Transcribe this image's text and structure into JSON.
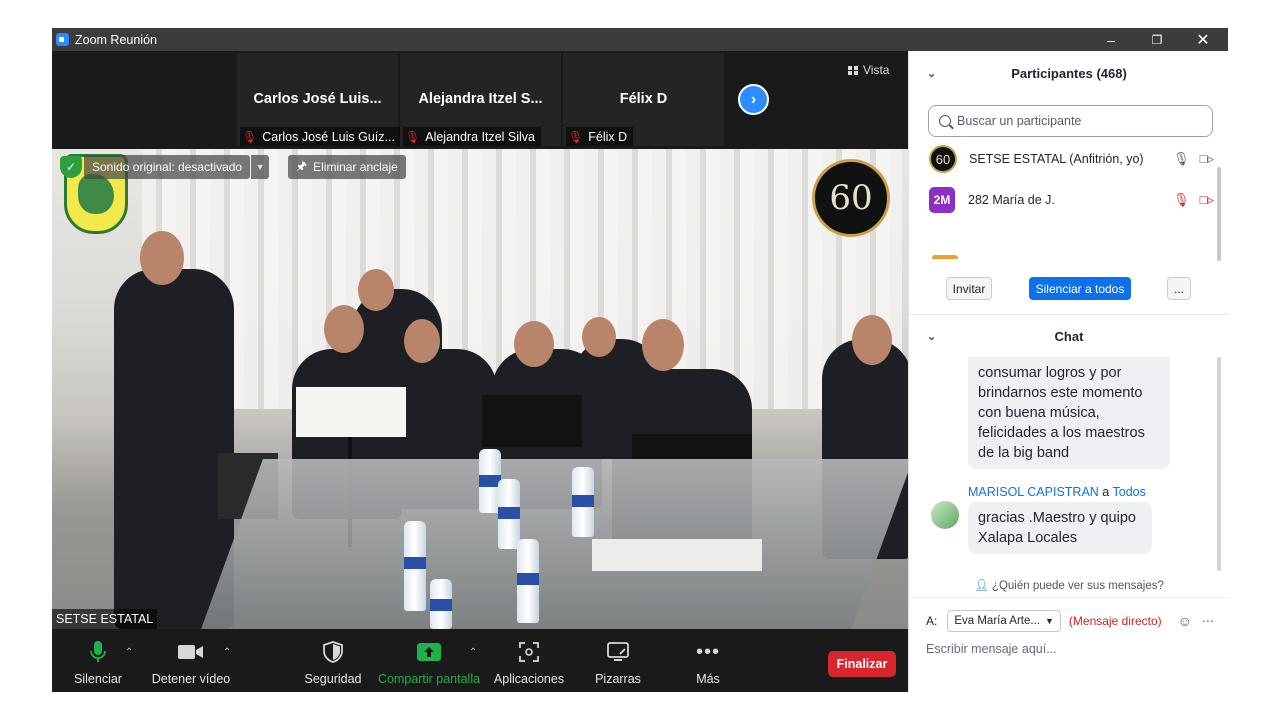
{
  "window": {
    "title": "Zoom Reunión"
  },
  "strip": {
    "thumbnails": [
      {
        "name": "Carlos José Luis...",
        "label": "Carlos José Luis Guíz..."
      },
      {
        "name": "Alejandra  Itzel S...",
        "label": "Alejandra Itzel Silva"
      },
      {
        "name": "Félix D",
        "label": "Félix D"
      }
    ],
    "view_label": "Vista"
  },
  "main_video": {
    "original_sound": "Sonido original: desactivado",
    "unpin": "Eliminar anclaje",
    "badge": "60",
    "speaker_name": "SETSE ESTATAL"
  },
  "toolbar": {
    "mute": "Silenciar",
    "stop_video": "Detener vídeo",
    "security": "Seguridad",
    "share_screen": "Compartir pantalla",
    "apps": "Aplicaciones",
    "whiteboards": "Pizarras",
    "more": "Más",
    "end": "Finalizar"
  },
  "participants": {
    "header": "Participantes (468)",
    "search_placeholder": "Buscar un participante",
    "list": [
      {
        "avatar": "60",
        "name": "SETSE ESTATAL (Anfitrión, yo)"
      },
      {
        "avatar": "2M",
        "name": "282 María de J."
      }
    ],
    "invite": "Invitar",
    "mute_all": "Silenciar a todos",
    "more": "..."
  },
  "chat": {
    "header": "Chat",
    "messages": [
      {
        "text": "consumar logros y por brindarnos este momento con buena música, felicidades a los maestros de la big band"
      },
      {
        "sender": "MARISOL CAPISTRAN",
        "sep": "a",
        "recipient": "Todos",
        "text": "gracias .Maestro y quipo Xalapa Locales"
      }
    ],
    "who_can_see": "¿Quién puede ver sus mensajes?",
    "to_label": "A:",
    "to_value": "Eva María Arte...",
    "direct_label": "(Mensaje directo)",
    "input_placeholder": "Escribir mensaje aquí..."
  },
  "colors": {
    "accent": "#0e71eb",
    "end": "#d8262e",
    "share": "#1fb14b"
  }
}
